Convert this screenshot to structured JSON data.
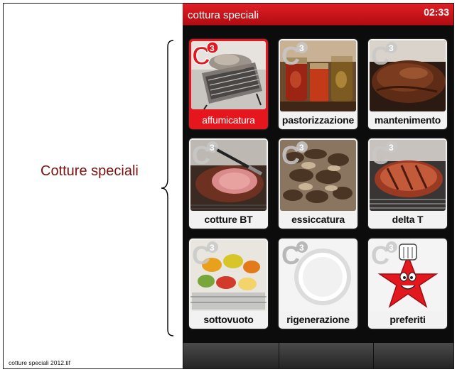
{
  "annotation": {
    "text": "Cotture speciali"
  },
  "file_caption": "cotture speciali 2012.tif",
  "screen": {
    "title": "cottura speciali",
    "clock": "02:33",
    "accent_color": "#e11f25",
    "logo_text": "C³",
    "tiles": [
      {
        "label": "affumicatura",
        "icon": "smoker-photo",
        "selected": true
      },
      {
        "label": "pastorizzazione",
        "icon": "jars-photo",
        "selected": false
      },
      {
        "label": "mantenimento",
        "icon": "roast-meat-photo",
        "selected": false
      },
      {
        "label": "cotture BT",
        "icon": "sliced-roast-photo",
        "selected": false
      },
      {
        "label": "essiccatura",
        "icon": "dried-mushrooms-photo",
        "selected": false
      },
      {
        "label": "delta T",
        "icon": "grilled-meat-photo",
        "selected": false
      },
      {
        "label": "sottovuoto",
        "icon": "vacuum-vegetables-photo",
        "selected": false
      },
      {
        "label": "rigenerazione",
        "icon": "plate-photo",
        "selected": false
      },
      {
        "label": "preferiti",
        "icon": "chef-star-icon",
        "selected": false
      }
    ],
    "bottom_buttons": [
      "",
      "",
      ""
    ]
  }
}
